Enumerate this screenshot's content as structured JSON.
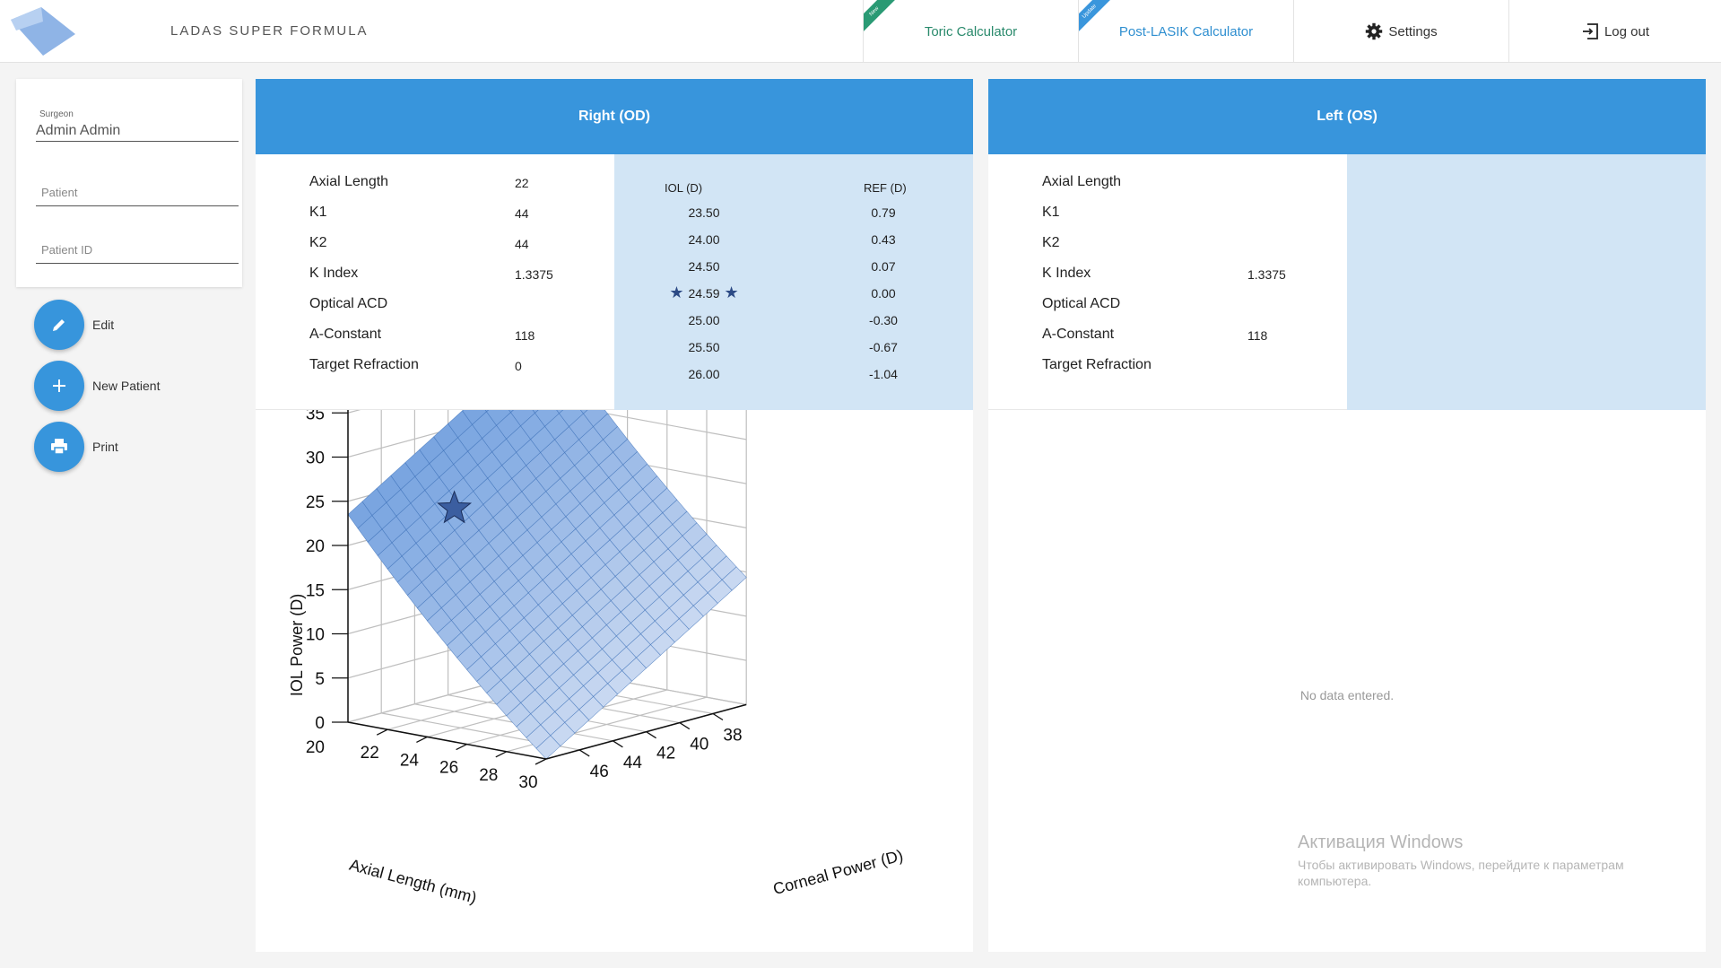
{
  "app": {
    "title": "LADAS SUPER FORMULA"
  },
  "nav": {
    "toric": {
      "label": "Toric Calculator",
      "ribbon": "New"
    },
    "lasik": {
      "label": "Post-LASIK Calculator",
      "ribbon": "Update"
    },
    "settings": {
      "label": "Settings",
      "icon": "gear-icon"
    },
    "logout": {
      "label": "Log out",
      "icon": "logout-icon"
    }
  },
  "patient": {
    "surgeon_label": "Surgeon",
    "surgeon_value": "Admin Admin",
    "patient_placeholder": "Patient",
    "patient_id_placeholder": "Patient ID"
  },
  "actions": [
    {
      "label": "Edit",
      "icon": "pencil-icon"
    },
    {
      "label": "New Patient",
      "icon": "plus-icon"
    },
    {
      "label": "Print",
      "icon": "printer-icon"
    }
  ],
  "right_eye": {
    "title": "Right (OD)",
    "params": [
      {
        "label": "Axial Length",
        "value": "22"
      },
      {
        "label": "K1",
        "value": "44"
      },
      {
        "label": "K2",
        "value": "44"
      },
      {
        "label": "K Index",
        "value": "1.3375"
      },
      {
        "label": "Optical ACD",
        "value": ""
      },
      {
        "label": "A-Constant",
        "value": "118"
      },
      {
        "label": "Target Refraction",
        "value": "0"
      }
    ],
    "results_headers": {
      "iol": "IOL (D)",
      "ref": "REF (D)"
    },
    "results": [
      {
        "iol": "23.50",
        "ref": "0.79"
      },
      {
        "iol": "24.00",
        "ref": "0.43"
      },
      {
        "iol": "24.50",
        "ref": "0.07"
      },
      {
        "iol": "24.59",
        "ref": "0.00",
        "highlight": true
      },
      {
        "iol": "25.00",
        "ref": "-0.30"
      },
      {
        "iol": "25.50",
        "ref": "-0.67"
      },
      {
        "iol": "26.00",
        "ref": "-1.04"
      }
    ]
  },
  "left_eye": {
    "title": "Left (OS)",
    "params": [
      {
        "label": "Axial Length",
        "value": ""
      },
      {
        "label": "K1",
        "value": ""
      },
      {
        "label": "K2",
        "value": ""
      },
      {
        "label": "K Index",
        "value": "1.3375"
      },
      {
        "label": "Optical ACD",
        "value": ""
      },
      {
        "label": "A-Constant",
        "value": "118"
      },
      {
        "label": "Target Refraction",
        "value": ""
      }
    ],
    "no_data": "No data entered."
  },
  "chart_data": {
    "type": "surface",
    "xlabel": "Axial Length (mm)",
    "ylabel": "Corneal Power (D)",
    "zlabel": "IOL Power (D)",
    "x_ticks": [
      "22",
      "24",
      "26",
      "28",
      "30"
    ],
    "y_ticks": [
      "38",
      "40",
      "42",
      "44",
      "46"
    ],
    "z_ticks": [
      "0",
      "5",
      "10",
      "15",
      "20",
      "25",
      "30",
      "35"
    ],
    "x_range": [
      20,
      30
    ],
    "y_range": [
      36,
      48
    ],
    "z_range": [
      0,
      35
    ],
    "grid": true,
    "surface_color": "#7aa5e0",
    "marker": {
      "axial_length": 22,
      "corneal_power": 44,
      "iol_power": 24.59,
      "symbol": "star"
    }
  },
  "watermark": {
    "title": "Активация Windows",
    "subtitle": "Чтобы активировать Windows, перейдите к параметрам компьютера."
  },
  "colors": {
    "primary": "#3895dc",
    "results_bg": "#d2e5f5",
    "toric": "#2a8a6c",
    "lasik": "#2f8fd0"
  }
}
